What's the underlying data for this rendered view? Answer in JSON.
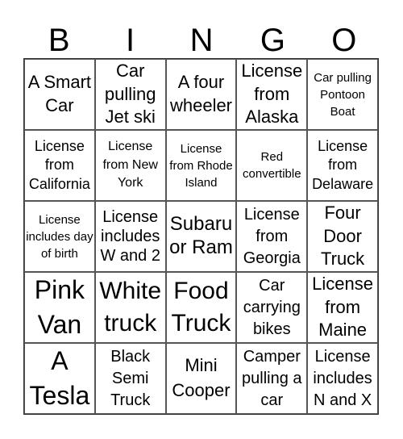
{
  "header": [
    "B",
    "I",
    "N",
    "G",
    "O"
  ],
  "cells": [
    "A Smart Car",
    "Car pulling Jet ski",
    "A four wheeler",
    "License from Alaska",
    "Car pulling Pontoon Boat",
    "License from California",
    "License from New York",
    "License from Rhode Island",
    "Red convertible",
    "License from Delaware",
    "License includes day of birth",
    "License includes W and 2",
    "Subaru or Ram",
    "License from Georgia",
    "Four Door Truck",
    "Pink Van",
    "White truck",
    "Food Truck",
    "Car carrying bikes",
    "License from Maine",
    "A Tesla",
    "Black Semi Truck",
    "Mini Cooper",
    "Camper pulling a car",
    "License includes N and X"
  ]
}
